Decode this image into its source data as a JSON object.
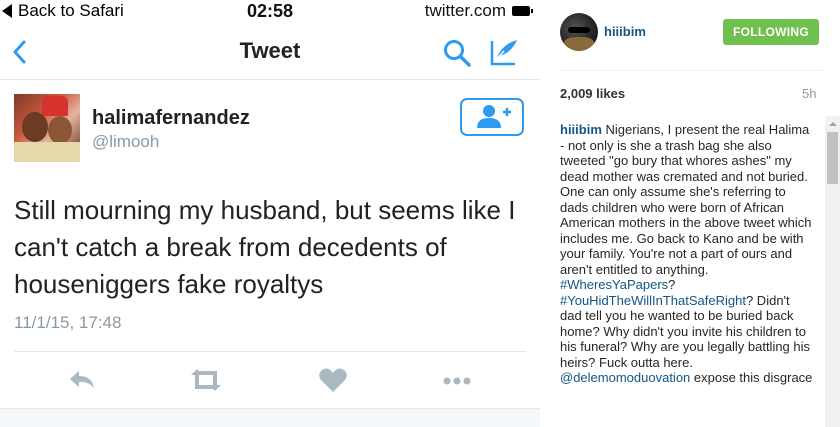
{
  "statusbar": {
    "back_label": "Back to Safari",
    "time": "02:58",
    "site": "twitter.com"
  },
  "navbar": {
    "title": "Tweet"
  },
  "tweet": {
    "display_name": "halimafernandez",
    "handle": "@limooh",
    "text": "Still mourning my husband, but seems like I can't catch a break from decedents of houseniggers fake royaltys",
    "timestamp": "11/1/15, 17:48"
  },
  "icons": {
    "back": "chevron-left-icon",
    "search": "search-icon",
    "compose": "compose-icon",
    "follow": "add-user-icon",
    "reply": "reply-icon",
    "retweet": "retweet-icon",
    "like": "heart-icon",
    "more": "more-icon"
  },
  "colors": {
    "twitter_blue": "#2d9bf0",
    "ig_link": "#125688",
    "ig_follow_green": "#70c050",
    "action_gray": "#aab8c2"
  },
  "instagram": {
    "username": "hiiibim",
    "follow_label": "FOLLOWING",
    "likes": "2,009 likes",
    "age": "5h",
    "caption": {
      "author": "hiiibim",
      "part1": " Nigerians, I present the real Halima - not only is she a trash bag she also tweeted \"go bury that whores ashes\" my dead mother was cremated and not buried. One can only assume she's referring to dads children who were born of African American mothers in the above tweet which includes me. Go back to Kano and be with your family. You're not a part of ours and aren't entitled to anything. ",
      "tag1": "#WheresYaPapers",
      "part2": "? ",
      "tag2": "#YouHidTheWillInThatSafeRight",
      "part3": "? Didn't dad tell you he wanted to be buried back home? Why didn't you invite his children to his funeral? Why are you legally battling his heirs? Fuck outta here. ",
      "mention": "@delemomoduovation",
      "part4": " expose this disgrace"
    }
  }
}
